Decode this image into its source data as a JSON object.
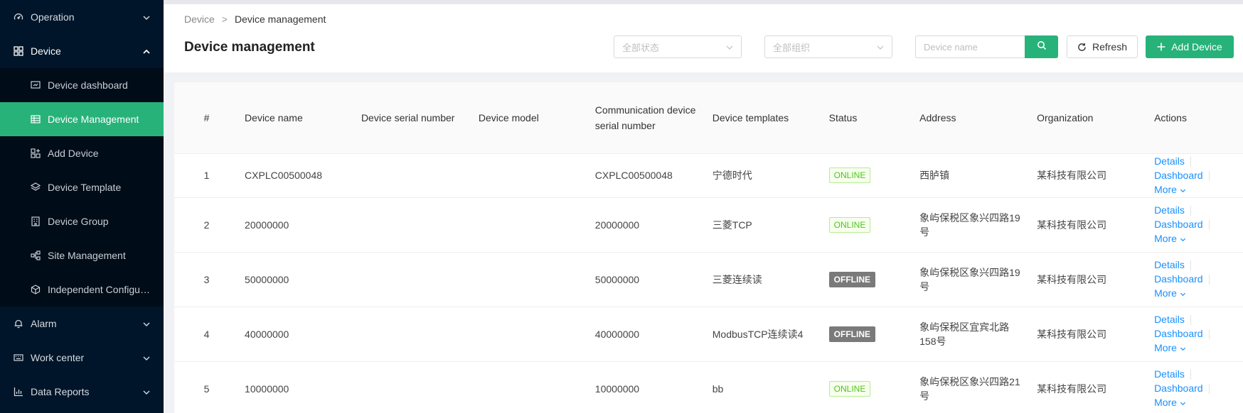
{
  "sidebar": {
    "items": [
      {
        "label": "Operation",
        "icon": "dashboard-gauge-icon",
        "expanded": false
      },
      {
        "label": "Device",
        "icon": "grid-icon",
        "expanded": true,
        "children": [
          {
            "label": "Device dashboard",
            "icon": "monitor-chart-icon"
          },
          {
            "label": "Device Management",
            "icon": "table-icon",
            "active": true
          },
          {
            "label": "Add Device",
            "icon": "add-grid-icon"
          },
          {
            "label": "Device Template",
            "icon": "layers-icon"
          },
          {
            "label": "Device Group",
            "icon": "building-icon"
          },
          {
            "label": "Site Management",
            "icon": "nodes-icon"
          },
          {
            "label": "Independent Configur...",
            "icon": "cube-icon"
          }
        ]
      },
      {
        "label": "Alarm",
        "icon": "bell-icon",
        "expanded": false
      },
      {
        "label": "Work center",
        "icon": "keyboard-icon",
        "expanded": false
      },
      {
        "label": "Data Reports",
        "icon": "bar-chart-icon",
        "expanded": false
      }
    ]
  },
  "breadcrumb": {
    "parent": "Device",
    "separator": ">",
    "current": "Device management"
  },
  "page_title": "Device management",
  "filters": {
    "status_placeholder": "全部状态",
    "org_placeholder": "全部组织",
    "search_placeholder": "Device name"
  },
  "buttons": {
    "refresh": "Refresh",
    "add": "Add Device"
  },
  "table": {
    "headers": [
      "#",
      "Device name",
      "Device serial number",
      "Device model",
      "Communication device serial number",
      "Device templates",
      "Status",
      "Address",
      "Organization",
      "Actions"
    ],
    "rows": [
      {
        "index": "1",
        "name": "CXPLC00500048",
        "serial": "",
        "model": "",
        "comm_serial": "CXPLC00500048",
        "template": "宁德时代",
        "status": "ONLINE",
        "address": "西胪镇",
        "org": "某科技有限公司"
      },
      {
        "index": "2",
        "name": "20000000",
        "serial": "",
        "model": "",
        "comm_serial": "20000000",
        "template": "三菱TCP",
        "status": "ONLINE",
        "address": "象屿保税区象兴四路19号",
        "org": "某科技有限公司"
      },
      {
        "index": "3",
        "name": "50000000",
        "serial": "",
        "model": "",
        "comm_serial": "50000000",
        "template": "三菱连续读",
        "status": "OFFLINE",
        "address": "象屿保税区象兴四路19号",
        "org": "某科技有限公司"
      },
      {
        "index": "4",
        "name": "40000000",
        "serial": "",
        "model": "",
        "comm_serial": "40000000",
        "template": "ModbusTCP连续读4",
        "status": "OFFLINE",
        "address": "象屿保税区宜宾北路158号",
        "org": "某科技有限公司"
      },
      {
        "index": "5",
        "name": "10000000",
        "serial": "",
        "model": "",
        "comm_serial": "10000000",
        "template": "bb",
        "status": "ONLINE",
        "address": "象屿保税区象兴四路21号",
        "org": "某科技有限公司"
      }
    ],
    "actions": {
      "details": "Details",
      "dashboard": "Dashboard",
      "more": "More"
    }
  },
  "colors": {
    "sidebar_bg": "#001529",
    "accent": "#27b27a",
    "link": "#1890ff",
    "online": "#52c41a",
    "offline": "#7a7a7a"
  }
}
